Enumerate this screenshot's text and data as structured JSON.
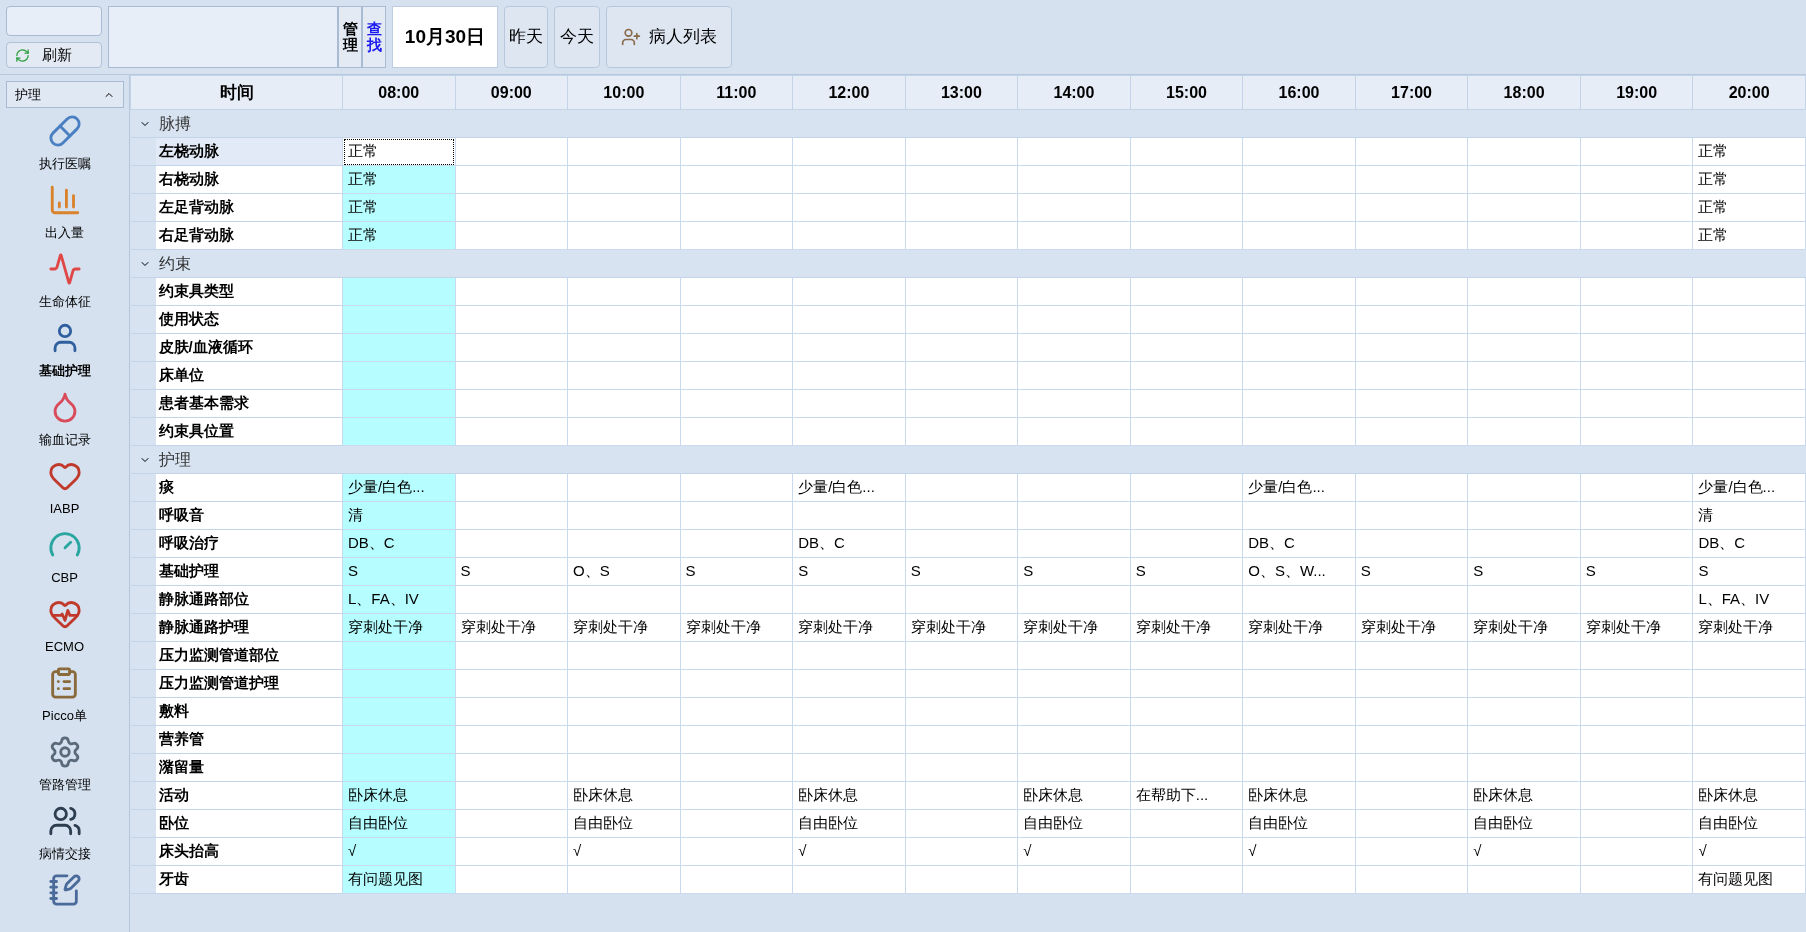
{
  "toolbar": {
    "refresh_button": "刷新",
    "manage_button": "管理",
    "find_link": "查找",
    "date": "10月30日",
    "yesterday_button": "昨天",
    "today_button": "今天",
    "patient_list_button": "病人列表"
  },
  "sidebar": {
    "dropdown": "护理",
    "items": [
      {
        "label": "执行医嘱",
        "selected": false
      },
      {
        "label": "出入量",
        "selected": false
      },
      {
        "label": "生命体征",
        "selected": false
      },
      {
        "label": "基础护理",
        "selected": true
      },
      {
        "label": "输血记录",
        "selected": false
      },
      {
        "label": "IABP",
        "selected": false
      },
      {
        "label": "CBP",
        "selected": false
      },
      {
        "label": "ECMO",
        "selected": false
      },
      {
        "label": "Picco单",
        "selected": false
      },
      {
        "label": "管路管理",
        "selected": false
      },
      {
        "label": "病情交接",
        "selected": false
      }
    ]
  },
  "table": {
    "corner": "时间",
    "columns": [
      {
        "label": "08:00",
        "selected": true
      },
      {
        "label": "09:00",
        "selected": false
      },
      {
        "label": "10:00",
        "selected": false
      },
      {
        "label": "11:00",
        "selected": false
      },
      {
        "label": "12:00",
        "selected": false
      },
      {
        "label": "13:00",
        "selected": false
      },
      {
        "label": "14:00",
        "selected": false
      },
      {
        "label": "15:00",
        "selected": false
      },
      {
        "label": "16:00",
        "selected": false
      },
      {
        "label": "17:00",
        "selected": false
      },
      {
        "label": "18:00",
        "selected": false
      },
      {
        "label": "19:00",
        "selected": false
      },
      {
        "label": "20:00",
        "selected": false
      }
    ],
    "groups": [
      {
        "label": "脉搏",
        "expanded": true,
        "rows": [
          {
            "label": "左桡动脉",
            "selected": true,
            "cells": [
              "正常",
              null,
              null,
              null,
              null,
              null,
              null,
              null,
              null,
              null,
              null,
              null,
              "正常"
            ]
          },
          {
            "label": "右桡动脉",
            "selected": false,
            "cells": [
              "正常",
              null,
              null,
              null,
              null,
              null,
              null,
              null,
              null,
              null,
              null,
              null,
              "正常"
            ]
          },
          {
            "label": "左足背动脉",
            "selected": false,
            "cells": [
              "正常",
              null,
              null,
              null,
              null,
              null,
              null,
              null,
              null,
              null,
              null,
              null,
              "正常"
            ]
          },
          {
            "label": "右足背动脉",
            "selected": false,
            "cells": [
              "正常",
              null,
              null,
              null,
              null,
              null,
              null,
              null,
              null,
              null,
              null,
              null,
              "正常"
            ]
          }
        ]
      },
      {
        "label": "约束",
        "expanded": true,
        "rows": [
          {
            "label": "约束具类型",
            "selected": false,
            "cells": [
              null,
              null,
              null,
              null,
              null,
              null,
              null,
              null,
              null,
              null,
              null,
              null,
              null
            ]
          },
          {
            "label": "使用状态",
            "selected": false,
            "cells": [
              null,
              null,
              null,
              null,
              null,
              null,
              null,
              null,
              null,
              null,
              null,
              null,
              null
            ]
          },
          {
            "label": "皮肤/血液循环",
            "selected": false,
            "cells": [
              null,
              null,
              null,
              null,
              null,
              null,
              null,
              null,
              null,
              null,
              null,
              null,
              null
            ]
          },
          {
            "label": "床单位",
            "selected": false,
            "cells": [
              null,
              null,
              null,
              null,
              null,
              null,
              null,
              null,
              null,
              null,
              null,
              null,
              null
            ]
          },
          {
            "label": "患者基本需求",
            "selected": false,
            "cells": [
              null,
              null,
              null,
              null,
              null,
              null,
              null,
              null,
              null,
              null,
              null,
              null,
              null
            ]
          },
          {
            "label": "约束具位置",
            "selected": false,
            "cells": [
              null,
              null,
              null,
              null,
              null,
              null,
              null,
              null,
              null,
              null,
              null,
              null,
              null
            ]
          }
        ]
      },
      {
        "label": "护理",
        "expanded": true,
        "rows": [
          {
            "label": "痰",
            "selected": false,
            "cells": [
              "少量/白色...",
              null,
              null,
              null,
              "少量/白色...",
              null,
              null,
              null,
              "少量/白色...",
              null,
              null,
              null,
              "少量/白色..."
            ]
          },
          {
            "label": "呼吸音",
            "selected": false,
            "cells": [
              "清",
              null,
              null,
              null,
              null,
              null,
              null,
              null,
              null,
              null,
              null,
              null,
              "清"
            ]
          },
          {
            "label": "呼吸治疗",
            "selected": false,
            "cells": [
              "DB、C",
              null,
              null,
              null,
              "DB、C",
              null,
              null,
              null,
              "DB、C",
              null,
              null,
              null,
              "DB、C"
            ]
          },
          {
            "label": "基础护理",
            "selected": false,
            "cells": [
              "S",
              "S",
              "O、S",
              "S",
              "S",
              "S",
              "S",
              "S",
              "O、S、W...",
              "S",
              "S",
              "S",
              "S"
            ]
          },
          {
            "label": "静脉通路部位",
            "selected": false,
            "cells": [
              "L、FA、IV",
              null,
              null,
              null,
              null,
              null,
              null,
              null,
              null,
              null,
              null,
              null,
              "L、FA、IV"
            ]
          },
          {
            "label": "静脉通路护理",
            "selected": false,
            "cells": [
              "穿刺处干净",
              "穿刺处干净",
              "穿刺处干净",
              "穿刺处干净",
              "穿刺处干净",
              "穿刺处干净",
              "穿刺处干净",
              "穿刺处干净",
              "穿刺处干净",
              "穿刺处干净",
              "穿刺处干净",
              "穿刺处干净",
              "穿刺处干净"
            ]
          },
          {
            "label": "压力监测管道部位",
            "selected": false,
            "cells": [
              null,
              null,
              null,
              null,
              null,
              null,
              null,
              null,
              null,
              null,
              null,
              null,
              null
            ]
          },
          {
            "label": "压力监测管道护理",
            "selected": false,
            "cells": [
              null,
              null,
              null,
              null,
              null,
              null,
              null,
              null,
              null,
              null,
              null,
              null,
              null
            ]
          },
          {
            "label": "敷料",
            "selected": false,
            "cells": [
              null,
              null,
              null,
              null,
              null,
              null,
              null,
              null,
              null,
              null,
              null,
              null,
              null
            ]
          },
          {
            "label": "营养管",
            "selected": false,
            "cells": [
              null,
              null,
              null,
              null,
              null,
              null,
              null,
              null,
              null,
              null,
              null,
              null,
              null
            ]
          },
          {
            "label": "潴留量",
            "selected": false,
            "cells": [
              null,
              null,
              null,
              null,
              null,
              null,
              null,
              null,
              null,
              null,
              null,
              null,
              null
            ]
          },
          {
            "label": "活动",
            "selected": false,
            "cells": [
              "卧床休息",
              null,
              "卧床休息",
              null,
              "卧床休息",
              null,
              "卧床休息",
              "在帮助下...",
              "卧床休息",
              null,
              "卧床休息",
              null,
              "卧床休息"
            ]
          },
          {
            "label": "卧位",
            "selected": false,
            "cells": [
              "自由卧位",
              null,
              "自由卧位",
              null,
              "自由卧位",
              null,
              "自由卧位",
              null,
              "自由卧位",
              null,
              "自由卧位",
              null,
              "自由卧位"
            ]
          },
          {
            "label": "床头抬高",
            "selected": false,
            "cells": [
              "√",
              null,
              "√",
              null,
              "√",
              null,
              "√",
              null,
              "√",
              null,
              "√",
              null,
              "√"
            ]
          },
          {
            "label": "牙齿",
            "selected": false,
            "cells": [
              "有问题见图",
              null,
              null,
              null,
              null,
              null,
              null,
              null,
              null,
              null,
              null,
              null,
              "有问题见图"
            ]
          }
        ]
      }
    ]
  }
}
